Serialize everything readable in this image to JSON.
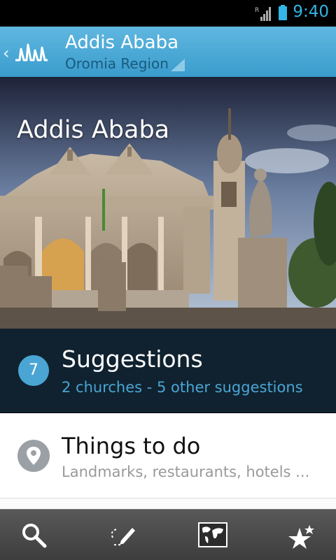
{
  "status_bar": {
    "time": "9:40",
    "network_label": "R"
  },
  "header": {
    "title": "Addis Ababa",
    "subtitle": "Oromia Region"
  },
  "hero": {
    "title": "Addis Ababa"
  },
  "suggestions": {
    "count": "7",
    "title": "Suggestions",
    "subtitle": "2 churches - 5 other suggestions"
  },
  "things_to_do": {
    "title": "Things to do",
    "subtitle": "Landmarks, restaurants, hotels ..."
  },
  "tabs": [
    "search-icon",
    "route-pencil-icon",
    "world-map-icon",
    "favorites-stars-icon"
  ],
  "colors": {
    "accent": "#33b5e5",
    "header": "#4aa8d8",
    "suggestions_bg": "#10222f",
    "badge": "#4aa5d4"
  }
}
